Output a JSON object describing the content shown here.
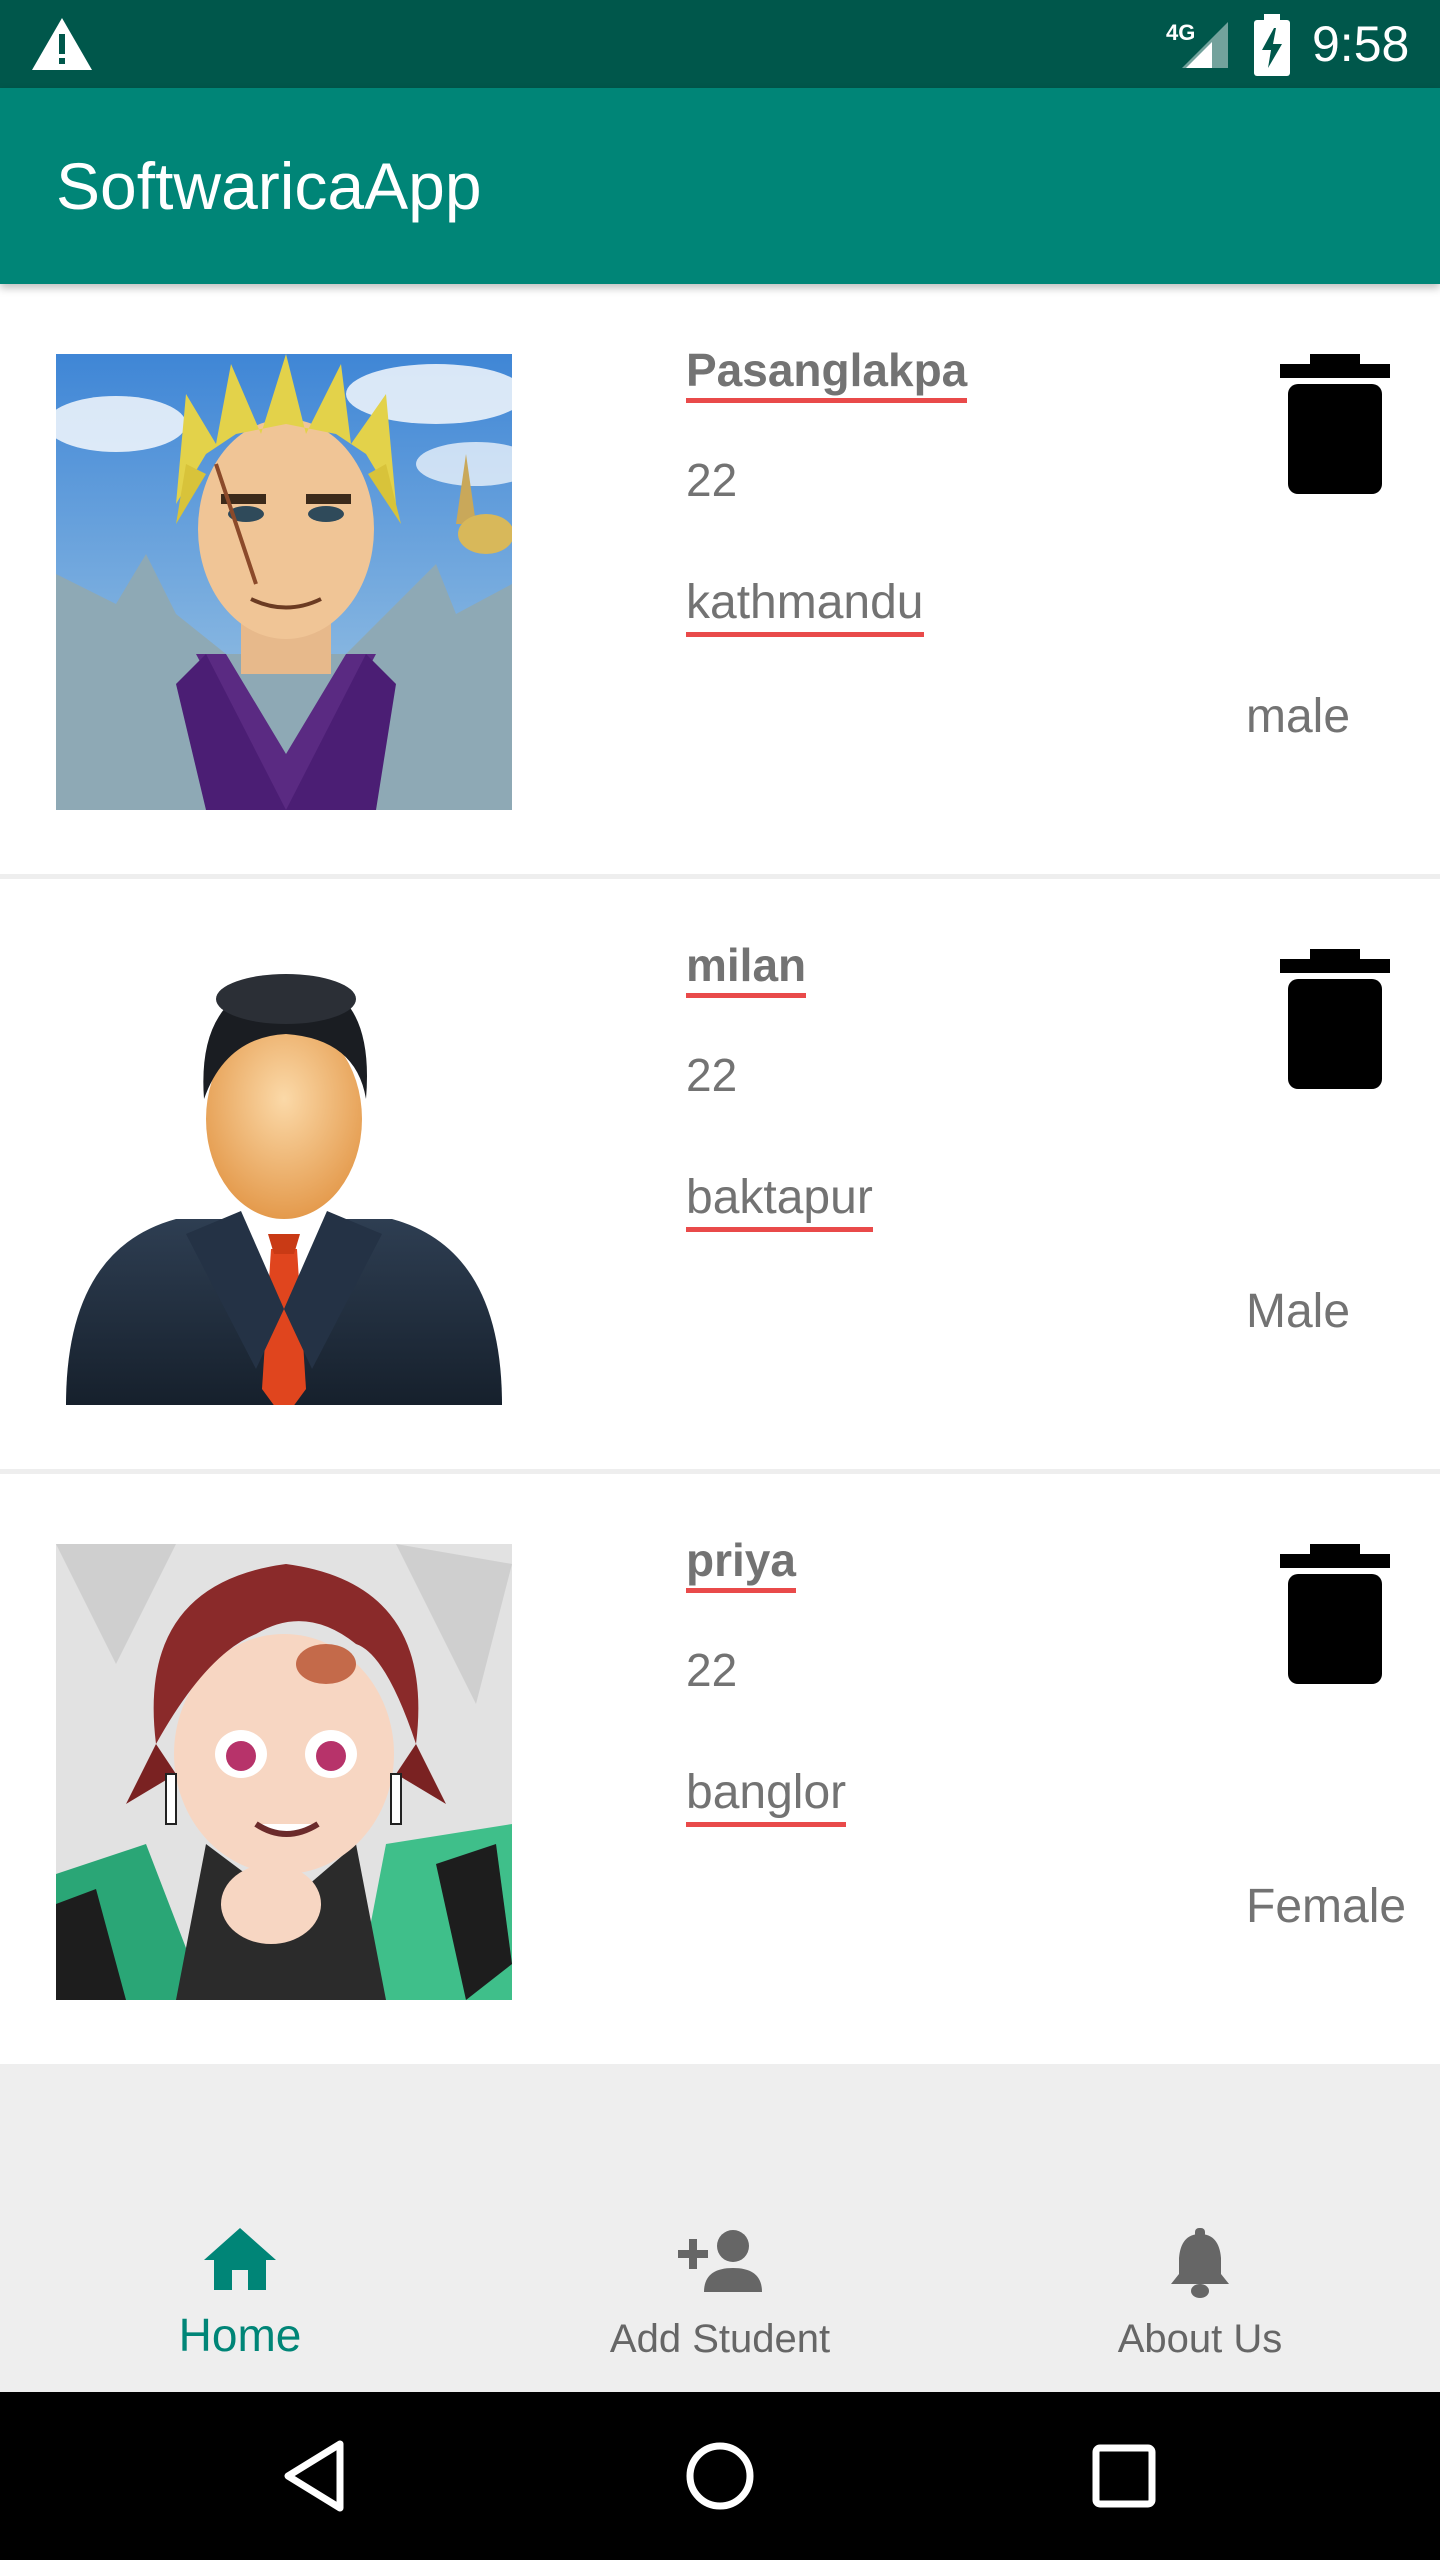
{
  "status_bar": {
    "time": "9:58",
    "network": "4G",
    "icons": [
      "warning-icon",
      "signal-icon",
      "battery-charging-icon"
    ]
  },
  "app_bar": {
    "title": "SoftwaricaApp"
  },
  "students": [
    {
      "name": "Pasanglakpa",
      "age": "22",
      "address": "kathmandu",
      "gender": "male",
      "avatar": "anime-blond-man-avatar",
      "delete_icon": "trash-icon"
    },
    {
      "name": "milan",
      "age": "22",
      "address": "baktapur",
      "gender": "Male",
      "avatar": "businessman-avatar",
      "delete_icon": "trash-icon"
    },
    {
      "name": "priya",
      "age": "22",
      "address": "banglor",
      "gender": "Female",
      "avatar": "anime-red-hair-avatar",
      "delete_icon": "trash-icon"
    }
  ],
  "bottom_nav": {
    "items": [
      {
        "label": "Home",
        "icon": "home-icon",
        "active": true
      },
      {
        "label": "Add Student",
        "icon": "add-person-icon",
        "active": false
      },
      {
        "label": "About Us",
        "icon": "bell-icon",
        "active": false
      }
    ]
  },
  "system_nav": {
    "buttons": [
      "back-icon",
      "home-circle-icon",
      "recents-icon"
    ]
  },
  "colors": {
    "primary": "#008577",
    "primary_dark": "#00574b",
    "underline": "#e94a4a",
    "text_gray": "#737373"
  }
}
